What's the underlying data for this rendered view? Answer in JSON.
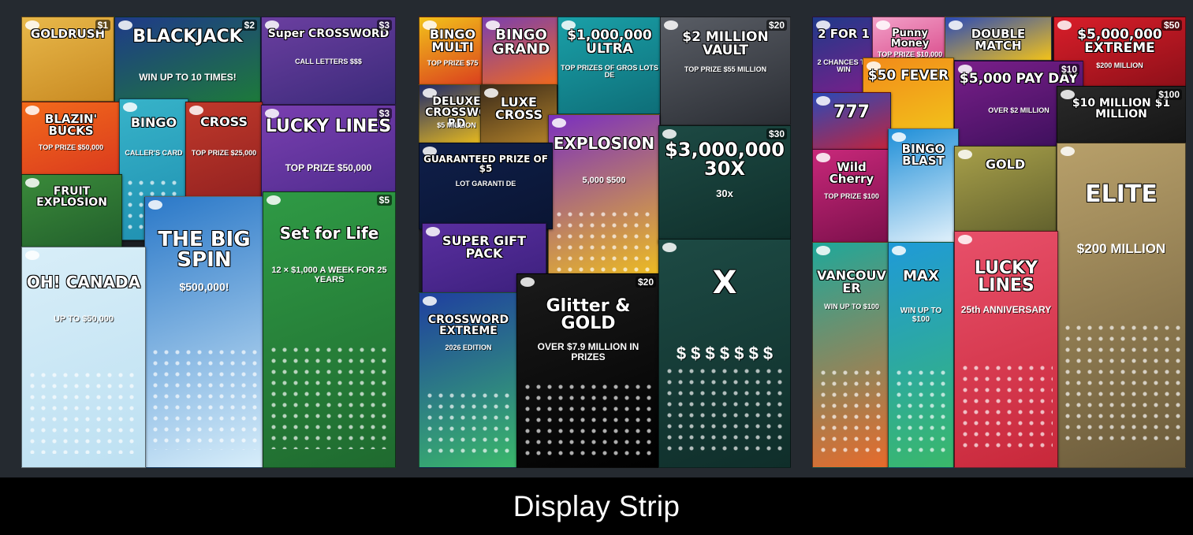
{
  "caption": "Display Strip",
  "panels": [
    {
      "name": "left",
      "tickets": [
        {
          "title": "GOLDRUSH",
          "price": "$1",
          "colors": [
            "#e8b84a",
            "#c98a22"
          ]
        },
        {
          "title": "BLACKJACK",
          "sub": "WIN UP TO 10 TIMES!",
          "price": "$2",
          "colors": [
            "#1f3a8a",
            "#1d7a3a"
          ]
        },
        {
          "title": "Super CROSSWORD",
          "sub": "CALL LETTERS $$$",
          "price": "$3",
          "colors": [
            "#6b3fa0",
            "#3b2a7a"
          ]
        },
        {
          "title": "BLAZIN' BUCKS",
          "sub": "TOP PRIZE $50,000",
          "colors": [
            "#f26a1b",
            "#d9381e"
          ]
        },
        {
          "title": "BINGO",
          "sub": "CALLER'S CARD",
          "colors": [
            "#37b3c9",
            "#1f8fb0"
          ]
        },
        {
          "title": "CROSS",
          "sub": "TOP PRIZE $25,000",
          "colors": [
            "#c0392b",
            "#8e1f1f"
          ]
        },
        {
          "title": "LUCKY LINES",
          "sub": "TOP PRIZE $50,000",
          "price": "$3",
          "colors": [
            "#7a3fb0",
            "#4a2a8a"
          ]
        },
        {
          "title": "FRUIT EXPLOSION",
          "colors": [
            "#3a8a3a",
            "#1f5a2a"
          ]
        },
        {
          "title": "THE BIG SPIN",
          "sub": "$500,000!",
          "colors": [
            "#2a78c8",
            "#d8eefa"
          ]
        },
        {
          "title": "Set for Life",
          "sub": "12 × $1,000 A WEEK FOR 25 YEARS",
          "price": "$5",
          "colors": [
            "#2f9a45",
            "#1f6a2f"
          ]
        },
        {
          "title": "OH! CANADA",
          "sub": "UP TO $50,000",
          "colors": [
            "#d8eef8",
            "#bde0f2"
          ]
        }
      ]
    },
    {
      "name": "middle",
      "tickets": [
        {
          "title": "BINGO MULTI",
          "sub": "TOP PRIZE $75",
          "colors": [
            "#f2c21a",
            "#d9381e"
          ]
        },
        {
          "title": "BINGO GRAND",
          "colors": [
            "#7a3fb0",
            "#f26a1b"
          ]
        },
        {
          "title": "$1,000,000 ULTRA",
          "sub": "TOP PRIZES OF GROS LOTS DE",
          "colors": [
            "#1aa0a8",
            "#0e6e78"
          ]
        },
        {
          "title": "$2 MILLION VAULT",
          "sub": "TOP PRIZE $55 MILLION",
          "price": "$20",
          "colors": [
            "#5a5e66",
            "#2a2d33"
          ]
        },
        {
          "title": "DELUXE CROSSWORD",
          "sub": "$5 MILLION",
          "colors": [
            "#1f2a6a",
            "#f2c21a"
          ]
        },
        {
          "title": "LUXE CROSS",
          "colors": [
            "#3a2a1a",
            "#b8862a"
          ]
        },
        {
          "title": "EXPLOSION",
          "sub": "5,000 $500",
          "colors": [
            "#7a2fc0",
            "#f2c21a"
          ]
        },
        {
          "title": "$3,000,000 30X",
          "sub": "30x",
          "price": "$30",
          "colors": [
            "#1d4a44",
            "#0f2e2a"
          ]
        },
        {
          "title": "GUARANTEED PRIZE OF $5",
          "sub": "LOT GARANTI DE",
          "colors": [
            "#0f1f4a",
            "#0a1533"
          ]
        },
        {
          "title": "SUPER GIFT PACK",
          "colors": [
            "#5a2fa0",
            "#3a1f7a"
          ]
        },
        {
          "title": "CROSSWORD EXTREME",
          "sub": "2026 EDITION",
          "colors": [
            "#1f3fa0",
            "#3ab86a"
          ]
        },
        {
          "title": "Glitter & GOLD",
          "sub": "OVER $7.9 MILLION IN PRIZES",
          "price": "$20",
          "colors": [
            "#1a1a1a",
            "#000000"
          ]
        },
        {
          "title": "X",
          "sub": "$ $ $ $ $ $ $",
          "colors": [
            "#1d4a44",
            "#0f2e2a"
          ]
        }
      ]
    },
    {
      "name": "right",
      "tickets": [
        {
          "title": "2 FOR 1",
          "sub": "2 CHANCES TO WIN",
          "colors": [
            "#1f3a8a",
            "#7a1f8a"
          ]
        },
        {
          "title": "Punny Money",
          "sub": "TOP PRIZE $10,000",
          "colors": [
            "#f2a0c8",
            "#d94a8a"
          ]
        },
        {
          "title": "DOUBLE MATCH",
          "colors": [
            "#2a4ab8",
            "#f2c21a"
          ]
        },
        {
          "title": "$5,000,000 EXTREME",
          "sub": "$200 MILLION",
          "price": "$50",
          "colors": [
            "#d91e2a",
            "#8a0f18"
          ]
        },
        {
          "title": "$50 FEVER",
          "colors": [
            "#f28a1a",
            "#f2c21a"
          ]
        },
        {
          "title": "$5,000 PAY DAY",
          "sub": "OVER $2 MILLION",
          "price": "$10",
          "colors": [
            "#7a1f8a",
            "#3a0f5a"
          ]
        },
        {
          "title": "777",
          "colors": [
            "#2a4ab8",
            "#d91e2a"
          ]
        },
        {
          "title": "$10 MILLION $1 MILLION",
          "price": "$100",
          "colors": [
            "#2a2a2a",
            "#111111"
          ]
        },
        {
          "title": "Wild Cherry",
          "sub": "TOP PRIZE $100",
          "colors": [
            "#c8287a",
            "#7a0f4a"
          ]
        },
        {
          "title": "BINGO BLAST",
          "colors": [
            "#1f8fd8",
            "#e8f4fc"
          ]
        },
        {
          "title": "GOLD",
          "colors": [
            "#a8a04a",
            "#5a5a2a"
          ]
        },
        {
          "title": "ELITE",
          "sub": "$200 MILLION",
          "colors": [
            "#b8a06a",
            "#6a5a3a"
          ]
        },
        {
          "title": "VANCOUVER",
          "sub": "WIN UP TO $100",
          "colors": [
            "#1fa89a",
            "#e86a2a"
          ]
        },
        {
          "title": "MAX",
          "sub": "WIN UP TO $100",
          "colors": [
            "#1f9ad8",
            "#3ab86a"
          ]
        },
        {
          "title": "LUCKY LINES",
          "sub": "25th ANNIVERSARY",
          "colors": [
            "#e8506a",
            "#c8283a"
          ]
        }
      ]
    }
  ]
}
